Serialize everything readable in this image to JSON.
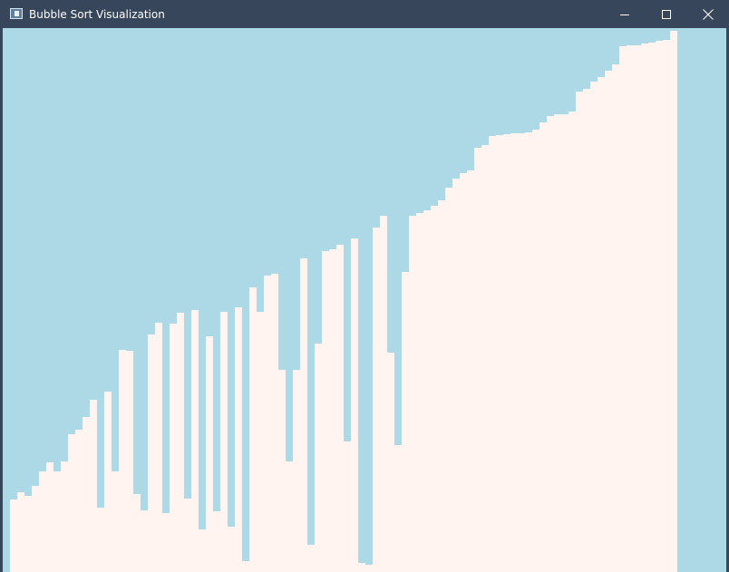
{
  "window": {
    "title": "Bubble Sort Visualization",
    "app_icon": "window-app-icon",
    "controls": [
      {
        "name": "minimize-icon"
      },
      {
        "name": "maximize-icon"
      },
      {
        "name": "close-icon"
      }
    ]
  },
  "colors": {
    "titlebar": "#37465a",
    "canvas_background": "#add8e6",
    "bar_fill": "#fff4ef"
  },
  "chart_data": {
    "type": "bar",
    "ylim": [
      0,
      600
    ],
    "values": [
      80,
      88,
      84,
      95,
      111,
      121,
      111,
      122,
      152,
      157,
      171,
      190,
      71,
      199,
      111,
      245,
      244,
      86,
      68,
      262,
      275,
      65,
      274,
      286,
      81,
      289,
      47,
      260,
      67,
      287,
      50,
      292,
      12,
      314,
      287,
      327,
      329,
      223,
      122,
      223,
      346,
      30,
      252,
      354,
      356,
      361,
      144,
      368,
      10,
      8,
      380,
      393,
      242,
      140,
      331,
      393,
      396,
      399,
      404,
      410,
      424,
      434,
      440,
      443,
      468,
      471,
      481,
      482,
      483,
      484,
      484,
      485,
      488,
      496,
      503,
      505,
      505,
      508,
      530,
      533,
      541,
      546,
      553,
      560,
      580,
      581,
      581,
      583,
      584,
      586,
      587,
      597
    ]
  }
}
